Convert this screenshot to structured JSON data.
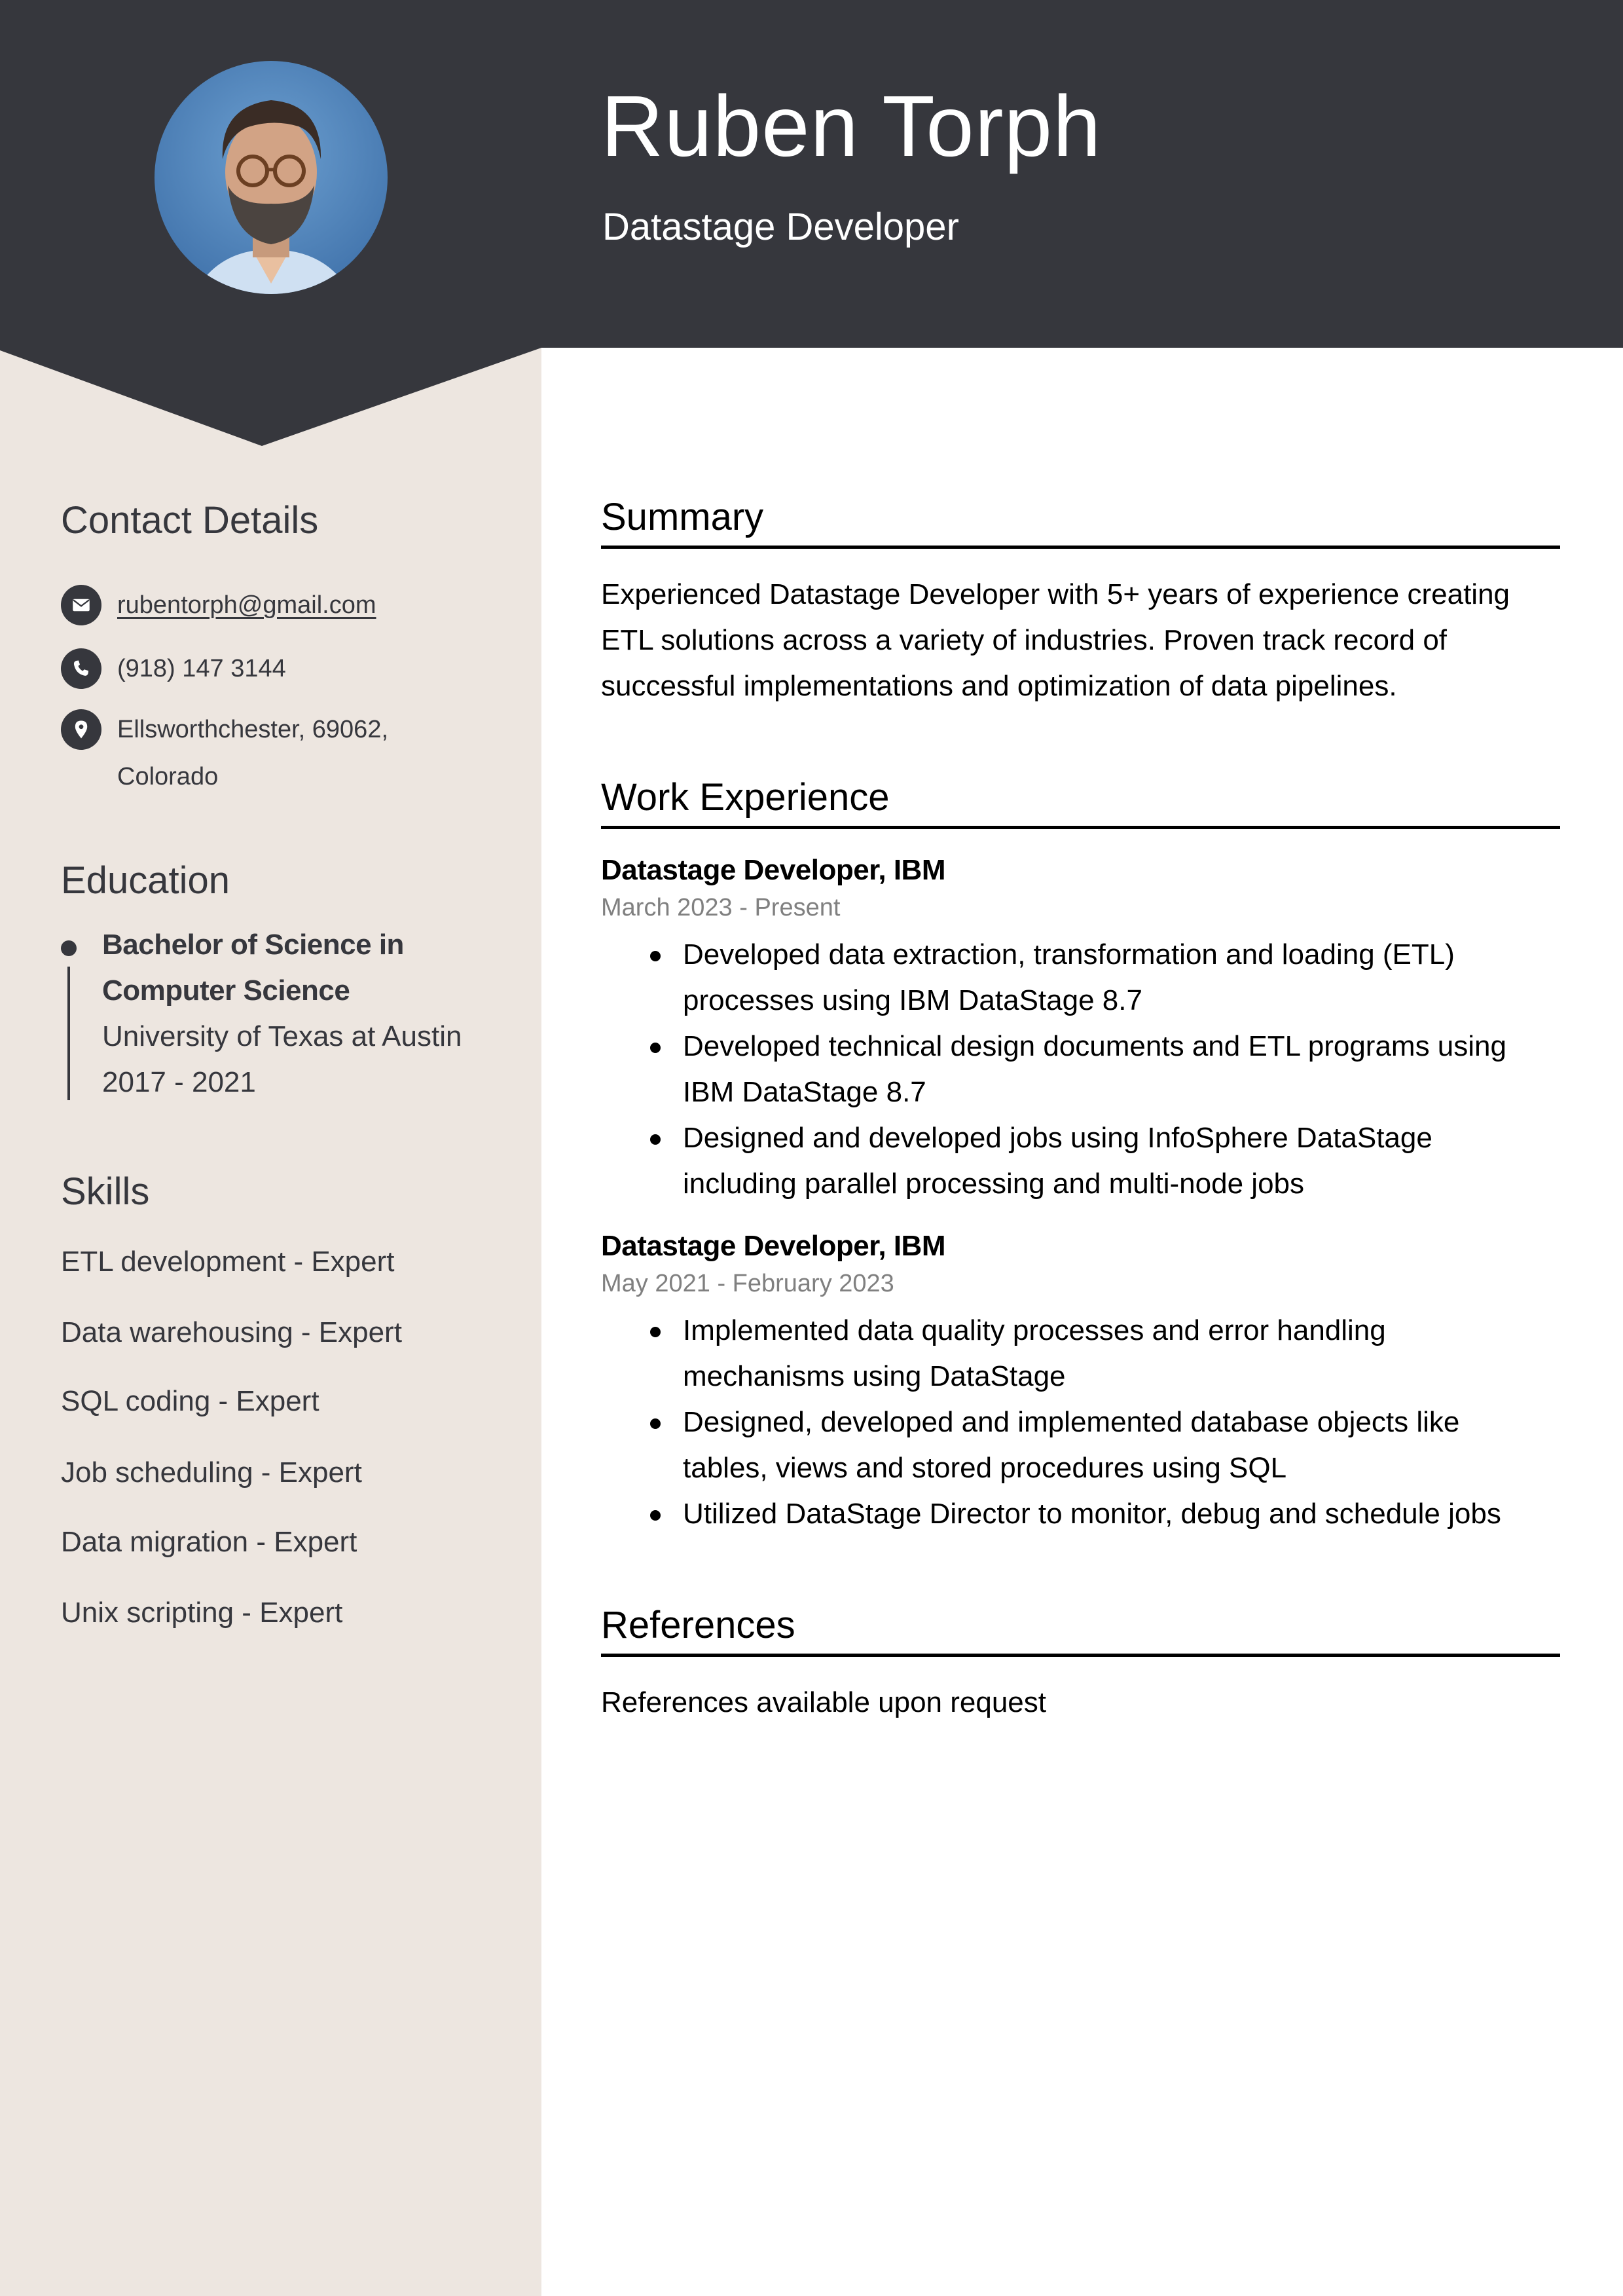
{
  "header": {
    "name": "Ruben Torph",
    "title": "Datastage Developer",
    "avatar_icon": "profile-photo",
    "colors": {
      "header_bg": "#36373d",
      "sidebar_bg": "#ede6e0",
      "accent_text": "#36373d"
    }
  },
  "sidebar": {
    "contact": {
      "heading": "Contact Details",
      "items": [
        {
          "icon": "envelope-icon",
          "text": "rubentorph@gmail.com"
        },
        {
          "icon": "phone-icon",
          "text": "(918) 147 3144"
        },
        {
          "icon": "location-pin-icon",
          "text": "Ellsworthchester, 69062,",
          "text2": "Colorado"
        }
      ]
    },
    "education": {
      "heading": "Education",
      "degree_line1": "Bachelor of Science in",
      "degree_line2": "Computer Science",
      "school": "University of Texas at Austin",
      "years": "2017 - 2021"
    },
    "skills": {
      "heading": "Skills",
      "items": [
        "ETL development - Expert",
        "Data warehousing - Expert",
        "SQL coding - Expert",
        "Job scheduling - Expert",
        "Data migration - Expert",
        "Unix scripting - Expert"
      ]
    }
  },
  "main": {
    "summary": {
      "heading": "Summary",
      "lines": [
        "Experienced Datastage Developer with 5+ years of experience creating",
        "ETL solutions across a variety of industries. Proven track record of",
        "successful implementations and optimization of data pipelines."
      ]
    },
    "experience": {
      "heading": "Work Experience",
      "jobs": [
        {
          "title": "Datastage Developer, IBM",
          "dates": "March 2023 - Present",
          "bullets": [
            [
              "Developed data extraction, transformation and loading (ETL)",
              "processes using IBM DataStage 8.7"
            ],
            [
              "Developed technical design documents and ETL programs using",
              "IBM DataStage 8.7"
            ],
            [
              "Designed and developed jobs using InfoSphere DataStage",
              "including parallel processing and multi-node jobs"
            ]
          ]
        },
        {
          "title": "Datastage Developer, IBM",
          "dates": "May 2021 - February 2023",
          "bullets": [
            [
              "Implemented data quality processes and error handling",
              "mechanisms using DataStage"
            ],
            [
              "Designed, developed and implemented database objects like",
              "tables, views and stored procedures using SQL"
            ],
            [
              "Utilized DataStage Director to monitor, debug and schedule jobs"
            ]
          ]
        }
      ]
    },
    "references": {
      "heading": "References",
      "text": "References available upon request"
    }
  }
}
